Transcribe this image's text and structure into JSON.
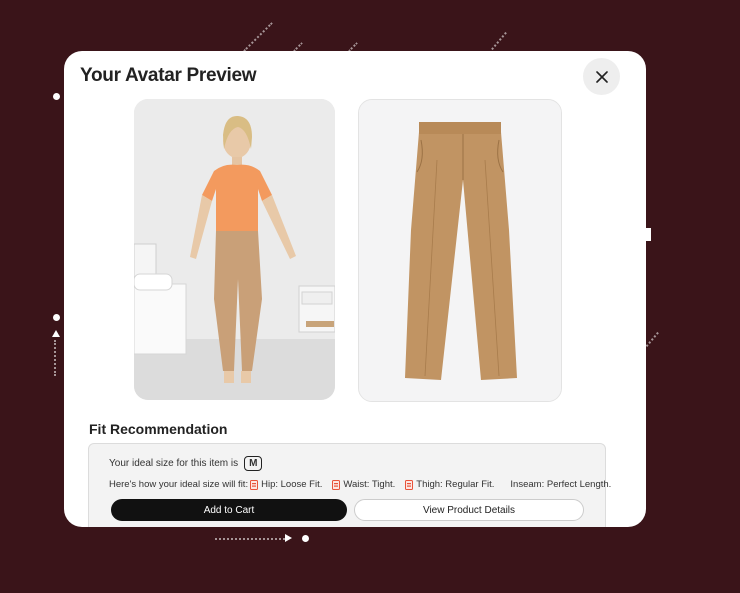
{
  "modal": {
    "title": "Your Avatar Preview",
    "close_icon": "close-icon"
  },
  "images": {
    "avatar": "avatar-photo-woman-orange-tshirt-tan-cargo-pants",
    "product": "product-photo-tan-trousers"
  },
  "fit": {
    "heading": "Fit Recommendation",
    "ideal_size_text": "Your ideal size for this item is",
    "ideal_size": "M",
    "details_intro": "Here's how your ideal size will fit:",
    "hip": "Hip: Loose Fit.",
    "waist": "Waist: Tight.",
    "thigh": "Thigh: Regular Fit.",
    "inseam": "Inseam: Perfect Length."
  },
  "actions": {
    "add_to_cart": "Add to Cart",
    "view_details": "View Product Details"
  },
  "colors": {
    "background": "#3a1419",
    "primary_button": "#111111",
    "fit_icon": "#e8533a"
  }
}
